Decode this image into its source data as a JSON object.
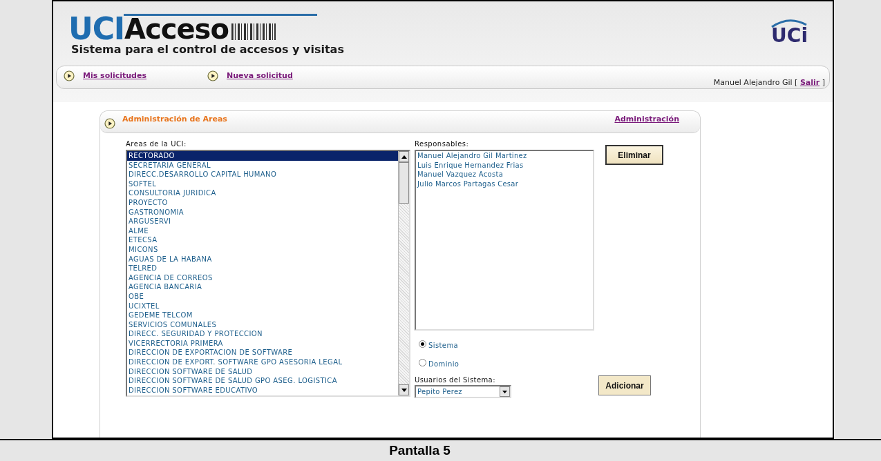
{
  "header": {
    "logo_primary": "UCI",
    "logo_secondary": "Acceso",
    "tagline": "Sistema para el control de accesos y visitas",
    "emblem": "UCi"
  },
  "nav": {
    "links": [
      "Mis solicitudes",
      "Nueva solicitud"
    ],
    "user_prefix": "Manuel Alejandro Gil [",
    "logout": "Salir",
    "user_suffix": "]"
  },
  "panel": {
    "title": "Administración de Areas",
    "link": "Administración"
  },
  "areas": {
    "label": "Areas de la UCI:",
    "items": [
      {
        "text": "RECTORADO",
        "selected": true
      },
      {
        "text": "SECRETARIA GENERAL",
        "selected": false
      },
      {
        "text": "DIRECC.DESARROLLO CAPITAL HUMANO",
        "selected": false
      },
      {
        "text": "SOFTEL",
        "selected": false
      },
      {
        "text": "CONSULTORIA JURIDICA",
        "selected": false
      },
      {
        "text": "PROYECTO",
        "selected": false
      },
      {
        "text": "GASTRONOMIA",
        "selected": false
      },
      {
        "text": "ARGUSERVI",
        "selected": false
      },
      {
        "text": "ALME",
        "selected": false
      },
      {
        "text": "ETECSA",
        "selected": false
      },
      {
        "text": "MICONS",
        "selected": false
      },
      {
        "text": "AGUAS DE LA HABANA",
        "selected": false
      },
      {
        "text": "TELRED",
        "selected": false
      },
      {
        "text": "AGENCIA DE CORREOS",
        "selected": false
      },
      {
        "text": "AGENCIA BANCARIA",
        "selected": false
      },
      {
        "text": "OBE",
        "selected": false
      },
      {
        "text": "UCIXTEL",
        "selected": false
      },
      {
        "text": "GEDEME TELCOM",
        "selected": false
      },
      {
        "text": "SERVICIOS COMUNALES",
        "selected": false
      },
      {
        "text": "DIRECC. SEGURIDAD Y PROTECCION",
        "selected": false
      },
      {
        "text": "VICERRECTORIA PRIMERA",
        "selected": false
      },
      {
        "text": "DIRECCION DE EXPORTACION DE SOFTWARE",
        "selected": false
      },
      {
        "text": "DIRECCION DE EXPORT. SOFTWARE GPO ASESORIA LEGAL",
        "selected": false
      },
      {
        "text": "DIRECCION SOFTWARE DE SALUD",
        "selected": false
      },
      {
        "text": "DIRECCION SOFTWARE DE SALUD GPO ASEG. LOGISTICA",
        "selected": false
      },
      {
        "text": "DIRECCION SOFTWARE EDUCATIVO",
        "selected": false
      }
    ]
  },
  "responsables": {
    "label": "Responsables:",
    "items": [
      "Manuel Alejandro Gil Martinez",
      "Luis Enrique Hernandez Frias",
      "Manuel Vazquez Acosta",
      "Julio Marcos Partagas Cesar"
    ]
  },
  "delete_button": "Eliminar",
  "user_type": [
    {
      "label": "Sistema",
      "selected": true
    },
    {
      "label": "Dominio",
      "selected": false
    }
  ],
  "system_users": {
    "label": "Usuarios del Sistema:",
    "value": "Pepito Perez"
  },
  "add_button": "Adicionar",
  "caption": "Pantalla 5"
}
